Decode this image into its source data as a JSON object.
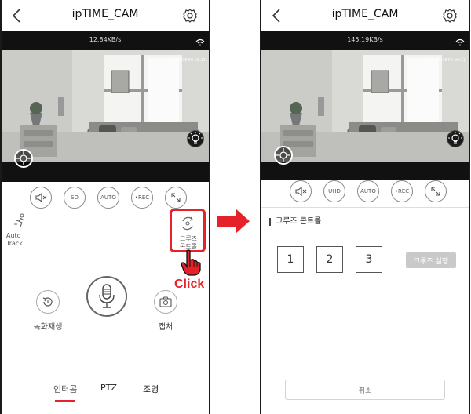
{
  "left_screen": {
    "title": "ipTIME_CAM",
    "speed": "12.84KB/s",
    "timestamp": "2022-08-08 Fri 09:11",
    "controls": [
      "SD",
      "AUTO",
      "•REC"
    ],
    "features": {
      "auto_track": "Auto\nTrack",
      "cruise_control": "크루즈\n콘트롤"
    },
    "actions": {
      "playback": "녹화재생",
      "capture": "캡처"
    },
    "tabs": [
      "인터콤",
      "PTZ",
      "조명"
    ],
    "active_tab": "인터콤",
    "click_label": "Click"
  },
  "right_screen": {
    "title": "ipTIME_CAM",
    "speed": "145.19KB/s",
    "timestamp": "2022-08-08 Fri 09:11",
    "controls": [
      "UHD",
      "AUTO",
      "•REC"
    ],
    "section_title": "크루즈 콘트롤",
    "presets": [
      "1",
      "2",
      "3"
    ],
    "run_button": "크루즈 실행",
    "cancel_button": "취소"
  },
  "colors": {
    "accent": "#e5222a",
    "run_button_bg": "#c9c9c9",
    "video_bg": "#111111"
  },
  "icons": [
    "back-chevron-icon",
    "gear-icon",
    "wifi-icon",
    "mute-speaker-icon",
    "ptz-joystick-icon",
    "light-bulb-icon",
    "auto-track-icon",
    "cruise-icon",
    "playback-icon",
    "microphone-icon",
    "camera-icon",
    "hand-pointer-icon",
    "arrow-right-icon"
  ]
}
